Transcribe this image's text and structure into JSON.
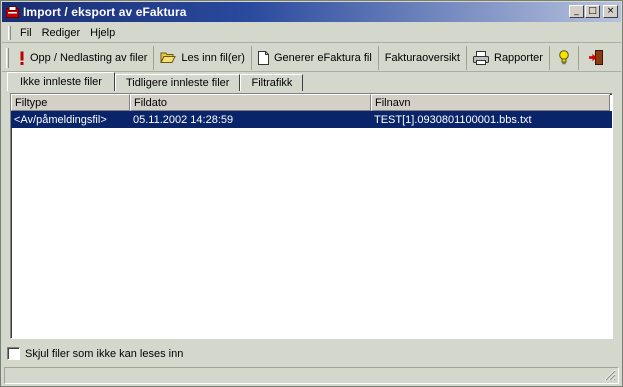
{
  "window": {
    "title": "Import / eksport av eFaktura",
    "minimize_glyph": "_",
    "maximize_glyph": "□",
    "close_glyph": "×"
  },
  "menu": {
    "items": [
      {
        "label": "Fil"
      },
      {
        "label": "Rediger"
      },
      {
        "label": "Hjelp"
      }
    ]
  },
  "toolbar": {
    "upload_download": "Opp / Nedlasting av filer",
    "read_files": "Les inn fil(er)",
    "generate": "Generer eFaktura fil",
    "invoice_overview": "Fakturaoversikt",
    "reports": "Rapporter"
  },
  "tabs": [
    {
      "label": "Ikke innleste filer",
      "active": true
    },
    {
      "label": "Tidligere innleste filer",
      "active": false
    },
    {
      "label": "Filtrafikk",
      "active": false
    }
  ],
  "table": {
    "columns": [
      "Filtype",
      "Fildato",
      "Filnavn"
    ],
    "rows": [
      {
        "filtype": "<Av/påmeldingsfil>",
        "fildato": "05.11.2002 14:28:59",
        "filnavn": "TEST[1].0930801100001.bbs.txt",
        "selected": true
      }
    ]
  },
  "footer": {
    "hide_unreadable_label": "Skjul filer som ikke kan leses inn",
    "hide_unreadable_checked": false
  },
  "colors": {
    "title_start": "#1a2d72",
    "selection": "#0a246a",
    "face": "#d4d8cc"
  }
}
